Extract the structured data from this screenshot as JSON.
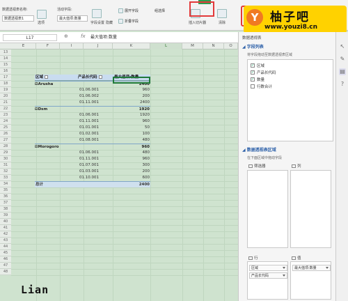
{
  "ribbon": {
    "pivot_name_label": "数据透视表名称:",
    "pivot_name_value": "数据透视表1",
    "options_label": "选项",
    "active_field_label": "活动字段:",
    "active_field_value": "最大值项:数量",
    "field_settings_label": "字段设置",
    "hide_label": "隐藏",
    "expand_label": "展开字段",
    "collapse_label": "折叠字段",
    "insert_slicer_label": "插入切片器",
    "group_select_label": "组选择",
    "clear_label": "清除",
    "refresh_label": "刷新"
  },
  "watermark": {
    "logo_letter": "Y",
    "title": "柚子吧",
    "url": "www.youzi8.cn"
  },
  "formula_bar": {
    "name_box": "L17",
    "fx": "fx",
    "content": "最大值项:数量"
  },
  "columns": [
    "E",
    "F",
    "I",
    "J",
    "K",
    "L",
    "M",
    "N",
    "O"
  ],
  "rows": [
    "13",
    "14",
    "15",
    "16",
    "17",
    "18",
    "19",
    "20",
    "21",
    "22",
    "23",
    "24",
    "25",
    "26",
    "27",
    "28",
    "29",
    "30",
    "31",
    "32",
    "33",
    "34",
    "35",
    "36",
    "37",
    "38",
    "39",
    "40",
    "41",
    "42",
    "43",
    "44",
    "45",
    "46",
    "47",
    "48"
  ],
  "pivot": {
    "headers": [
      "区域",
      "产品长代码",
      "最大值项:数量"
    ],
    "groups": [
      {
        "name": "Arusha",
        "total": "2400",
        "items": [
          {
            "code": "01.06.001",
            "value": "960"
          },
          {
            "code": "01.06.002",
            "value": "200"
          },
          {
            "code": "01.11.001",
            "value": "2400"
          }
        ]
      },
      {
        "name": "Dsm",
        "total": "1920",
        "items": [
          {
            "code": "01.06.001",
            "value": "1920"
          },
          {
            "code": "01.11.001",
            "value": "960"
          },
          {
            "code": "01.01.001",
            "value": "50"
          },
          {
            "code": "01.02.001",
            "value": "100"
          },
          {
            "code": "01.08.001",
            "value": "480"
          }
        ]
      },
      {
        "name": "Morogoro",
        "total": "960",
        "items": [
          {
            "code": "01.06.001",
            "value": "480"
          },
          {
            "code": "01.11.001",
            "value": "960"
          },
          {
            "code": "01.07.001",
            "value": "300"
          },
          {
            "code": "01.03.001",
            "value": "200"
          },
          {
            "code": "01.10.001",
            "value": "600"
          }
        ]
      }
    ],
    "grand_total_label": "总计",
    "grand_total_value": "2400"
  },
  "signature": "Lian",
  "panel": {
    "title": "数据透视表",
    "fields_section": "字段列表",
    "fields_hint": "将字段拖动至数据透视表区域",
    "fields": [
      {
        "label": "区域",
        "checked": true
      },
      {
        "label": "产品长代码",
        "checked": true
      },
      {
        "label": "数量",
        "checked": true
      },
      {
        "label": "行数合计",
        "checked": false
      }
    ],
    "areas_section": "数据透视表区域",
    "areas_hint": "在下面区域中拖动字段",
    "filters_label": "筛选器",
    "columns_label": "列",
    "rows_label": "行",
    "values_label": "值",
    "row_items": [
      "区域",
      "产品长代码"
    ],
    "value_items": [
      "最大值项:数量"
    ]
  }
}
